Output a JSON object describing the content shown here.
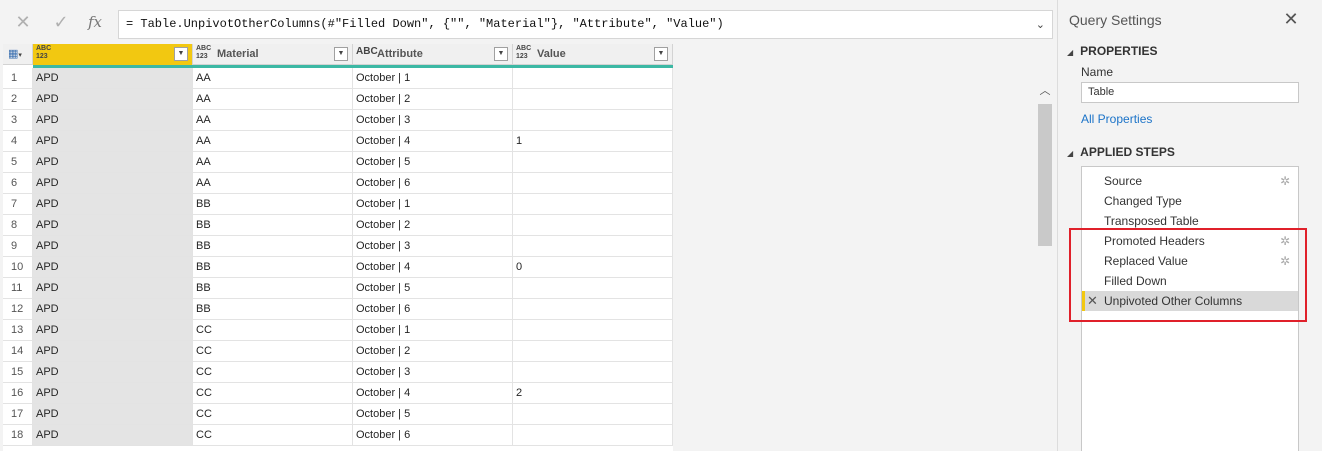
{
  "formula_bar": {
    "cancel_icon": "close-icon",
    "commit_icon": "check-icon",
    "fx_label": "fx",
    "formula": "= Table.UnpivotOtherColumns(#\"Filled Down\", {\"\", \"Material\"}, \"Attribute\", \"Value\")"
  },
  "grid": {
    "columns": [
      {
        "type": "ABC\n123",
        "name": ""
      },
      {
        "type": "ABC\n123",
        "name": "Material"
      },
      {
        "type": "ABC",
        "name": "Attribute"
      },
      {
        "type": "ABC\n123",
        "name": "Value"
      }
    ],
    "rows": [
      {
        "n": "1",
        "c1": "APD",
        "c2": "AA",
        "c3": "October | 1",
        "c4": ""
      },
      {
        "n": "2",
        "c1": "APD",
        "c2": "AA",
        "c3": "October | 2",
        "c4": ""
      },
      {
        "n": "3",
        "c1": "APD",
        "c2": "AA",
        "c3": "October | 3",
        "c4": ""
      },
      {
        "n": "4",
        "c1": "APD",
        "c2": "AA",
        "c3": "October | 4",
        "c4": "1"
      },
      {
        "n": "5",
        "c1": "APD",
        "c2": "AA",
        "c3": "October | 5",
        "c4": ""
      },
      {
        "n": "6",
        "c1": "APD",
        "c2": "AA",
        "c3": "October | 6",
        "c4": ""
      },
      {
        "n": "7",
        "c1": "APD",
        "c2": "BB",
        "c3": "October | 1",
        "c4": ""
      },
      {
        "n": "8",
        "c1": "APD",
        "c2": "BB",
        "c3": "October | 2",
        "c4": ""
      },
      {
        "n": "9",
        "c1": "APD",
        "c2": "BB",
        "c3": "October | 3",
        "c4": ""
      },
      {
        "n": "10",
        "c1": "APD",
        "c2": "BB",
        "c3": "October | 4",
        "c4": "0"
      },
      {
        "n": "11",
        "c1": "APD",
        "c2": "BB",
        "c3": "October | 5",
        "c4": ""
      },
      {
        "n": "12",
        "c1": "APD",
        "c2": "BB",
        "c3": "October | 6",
        "c4": ""
      },
      {
        "n": "13",
        "c1": "APD",
        "c2": "CC",
        "c3": "October | 1",
        "c4": ""
      },
      {
        "n": "14",
        "c1": "APD",
        "c2": "CC",
        "c3": "October | 2",
        "c4": ""
      },
      {
        "n": "15",
        "c1": "APD",
        "c2": "CC",
        "c3": "October | 3",
        "c4": ""
      },
      {
        "n": "16",
        "c1": "APD",
        "c2": "CC",
        "c3": "October | 4",
        "c4": "2"
      },
      {
        "n": "17",
        "c1": "APD",
        "c2": "CC",
        "c3": "October | 5",
        "c4": ""
      },
      {
        "n": "18",
        "c1": "APD",
        "c2": "CC",
        "c3": "October | 6",
        "c4": ""
      }
    ]
  },
  "settings": {
    "title": "Query Settings",
    "properties_header": "PROPERTIES",
    "name_label": "Name",
    "name_value": "Table",
    "all_properties": "All Properties",
    "applied_steps_header": "APPLIED STEPS",
    "steps": [
      {
        "label": "Source",
        "gear": true
      },
      {
        "label": "Changed Type",
        "gear": false
      },
      {
        "label": "Transposed Table",
        "gear": false
      },
      {
        "label": "Promoted Headers",
        "gear": true
      },
      {
        "label": "Replaced Value",
        "gear": true
      },
      {
        "label": "Filled Down",
        "gear": false
      },
      {
        "label": "Unpivoted Other Columns",
        "gear": false,
        "active": true
      }
    ]
  },
  "colors": {
    "selected_column": "#f2c811",
    "quality_bar": "#3cb8a4",
    "highlight_box": "#e0202a",
    "link": "#1b73c8"
  }
}
